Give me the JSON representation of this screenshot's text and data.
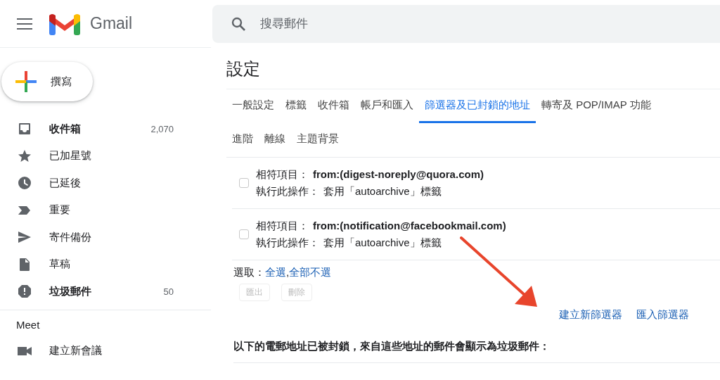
{
  "header": {
    "brand": "Gmail",
    "search": {
      "placeholder": "搜尋郵件"
    }
  },
  "compose": {
    "label": "撰寫"
  },
  "sidebar": {
    "items": [
      {
        "label": "收件箱",
        "count": "2,070",
        "unread": true
      },
      {
        "label": "已加星號",
        "unread": false
      },
      {
        "label": "已延後",
        "unread": false
      },
      {
        "label": "重要",
        "unread": false
      },
      {
        "label": "寄件備份",
        "unread": false
      },
      {
        "label": "草稿",
        "unread": false
      },
      {
        "label": "垃圾郵件",
        "count": "50",
        "unread": true
      }
    ],
    "meet": {
      "heading": "Meet",
      "items": [
        {
          "label": "建立新會議"
        }
      ]
    }
  },
  "settings": {
    "title": "設定",
    "tab_rows": [
      [
        {
          "label": "一般設定",
          "selected": false
        },
        {
          "label": "標籤",
          "selected": false
        },
        {
          "label": "收件箱",
          "selected": false
        },
        {
          "label": "帳戶和匯入",
          "selected": false
        },
        {
          "label": "篩選器及已封鎖的地址",
          "selected": true
        },
        {
          "label": "轉寄及 POP/IMAP 功能",
          "selected": false
        }
      ],
      [
        {
          "label": "進階",
          "selected": false
        },
        {
          "label": "離線",
          "selected": false
        },
        {
          "label": "主題背景",
          "selected": false
        }
      ]
    ],
    "filters": [
      {
        "checked": false,
        "match_label": "相符項目：",
        "match": "from:(digest-noreply@quora.com)",
        "action_label": "執行此操作：",
        "action": "套用「autoarchive」標籤"
      },
      {
        "checked": false,
        "match_label": "相符項目：",
        "match": "from:(notification@facebookmail.com)",
        "action_label": "執行此操作：",
        "action": "套用「autoarchive」標籤"
      }
    ],
    "select": {
      "label": "選取：",
      "links": [
        "全選",
        "全部不選"
      ],
      "separator": ","
    },
    "buttons": [
      {
        "label": "匯出",
        "disabled": true
      },
      {
        "label": "刪除",
        "disabled": true
      }
    ],
    "links": [
      "建立新篩選器",
      "匯入篩選器"
    ],
    "blocked_heading": "以下的電郵地址已被封鎖，來自這些地址的郵件會顯示為垃圾郵件："
  }
}
